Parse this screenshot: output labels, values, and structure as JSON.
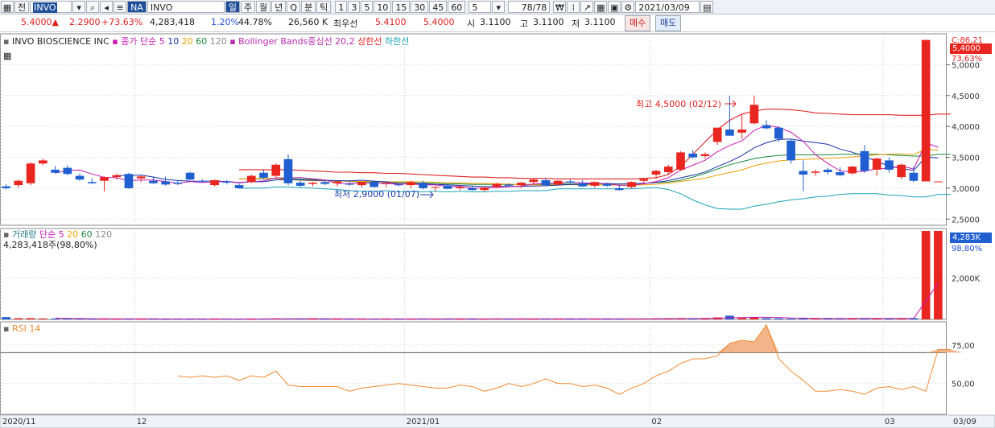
{
  "toolbar": {
    "market_label": "전",
    "symbol_code": "INVO",
    "exchange_badge": "NA",
    "stock_name": "INVO BIOSCIENCE",
    "periods": [
      "일",
      "주",
      "월",
      "년",
      "Q",
      "분",
      "틱"
    ],
    "intervals": [
      "1",
      "3",
      "5",
      "10",
      "15",
      "30",
      "45",
      "60"
    ],
    "interval_value": "5",
    "count_display": "78/78",
    "date_value": "2021/03/09"
  },
  "quote": {
    "price": "5.4000▲",
    "change": "2.2900",
    "change_pct": "+73.63%",
    "volume": "4,283,418",
    "vol_ratio": "1.20%",
    "turnover_pct": "44.78%",
    "amount": "26,560 K",
    "best_label": "최우선",
    "best_ask": "5.4100",
    "best_bid": "5.4000",
    "open_label": "시",
    "open": "3.1100",
    "high_label": "고",
    "high": "3.1100",
    "low_label": "저",
    "low": "3.1100",
    "buy_button": "매수",
    "sell_button": "매도"
  },
  "colors": {
    "up": "#e8251f",
    "down": "#1f5fcf",
    "ma5": "#c81ab4",
    "ma10": "#1632a8",
    "ma20": "#f0a000",
    "ma60": "#1c8a3c",
    "bb_upper": "#e02424",
    "bb_lower": "#1aa3b8",
    "rsi": "#ef8a30"
  },
  "price_legend": {
    "name": "INVO BIOSCIENCE INC",
    "ma_label": "종가 단순",
    "ma_periods": [
      "5",
      "10",
      "20",
      "60",
      "120"
    ],
    "bb_label": "Bollinger Bands중심선 20,2",
    "upper_label": "상한선",
    "lower_label": "하한선"
  },
  "volume_legend": {
    "label": "거래량",
    "ma_label": "단순",
    "ma_periods": [
      "5",
      "20",
      "60",
      "120"
    ],
    "current": "4,283,418주(98,80%)"
  },
  "rsi_legend": {
    "label": "RSI 14"
  },
  "annotations": {
    "high": "최고 4,5000 (02/12)",
    "low": "최저 2,9000 (01/07)",
    "price_current": "5,4000",
    "price_top": "C:86,21",
    "price_pct": "73,63%",
    "volume_current": "4,283K",
    "volume_pct": "98,80%"
  },
  "chart_data": [
    {
      "type": "candlestick",
      "title": "INVO BIOSCIENCE INC",
      "y_ticks": [
        "2,5000",
        "3,0000",
        "3,5000",
        "4,0000",
        "4,5000",
        "5,0000"
      ],
      "ylim": [
        2.4,
        5.5
      ],
      "x_ticks": [
        "2020/11",
        "12",
        "2021/01",
        "02",
        "03",
        "03/09"
      ],
      "candles": [
        {
          "o": 3.03,
          "h": 3.07,
          "l": 2.98,
          "c": 3.0
        },
        {
          "o": 3.05,
          "h": 3.14,
          "l": 3.01,
          "c": 3.12
        },
        {
          "o": 3.08,
          "h": 3.42,
          "l": 3.05,
          "c": 3.4
        },
        {
          "o": 3.4,
          "h": 3.48,
          "l": 3.37,
          "c": 3.45
        },
        {
          "o": 3.3,
          "h": 3.36,
          "l": 3.24,
          "c": 3.25
        },
        {
          "o": 3.33,
          "h": 3.37,
          "l": 3.21,
          "c": 3.23
        },
        {
          "o": 3.2,
          "h": 3.24,
          "l": 3.12,
          "c": 3.14
        },
        {
          "o": 3.1,
          "h": 3.16,
          "l": 3.07,
          "c": 3.08
        },
        {
          "o": 3.12,
          "h": 3.19,
          "l": 2.95,
          "c": 3.18
        },
        {
          "o": 3.18,
          "h": 3.23,
          "l": 3.14,
          "c": 3.21
        },
        {
          "o": 3.23,
          "h": 3.25,
          "l": 2.99,
          "c": 3.0
        },
        {
          "o": 3.16,
          "h": 3.2,
          "l": 3.1,
          "c": 3.19
        },
        {
          "o": 3.12,
          "h": 3.18,
          "l": 3.07,
          "c": 3.08
        },
        {
          "o": 3.11,
          "h": 3.19,
          "l": 3.04,
          "c": 3.06
        },
        {
          "o": 3.09,
          "h": 3.13,
          "l": 3.05,
          "c": 3.07
        },
        {
          "o": 3.25,
          "h": 3.27,
          "l": 3.13,
          "c": 3.14
        },
        {
          "o": 3.12,
          "h": 3.14,
          "l": 3.09,
          "c": 3.11
        },
        {
          "o": 3.05,
          "h": 3.14,
          "l": 3.03,
          "c": 3.13
        },
        {
          "o": 3.11,
          "h": 3.13,
          "l": 3.06,
          "c": 3.09
        },
        {
          "o": 3.05,
          "h": 3.07,
          "l": 2.99,
          "c": 3.0
        },
        {
          "o": 3.1,
          "h": 3.22,
          "l": 3.08,
          "c": 3.2
        },
        {
          "o": 3.25,
          "h": 3.3,
          "l": 3.15,
          "c": 3.17
        },
        {
          "o": 3.2,
          "h": 3.4,
          "l": 3.18,
          "c": 3.38
        },
        {
          "o": 3.47,
          "h": 3.55,
          "l": 3.05,
          "c": 3.08
        },
        {
          "o": 3.09,
          "h": 3.12,
          "l": 3.02,
          "c": 3.04
        },
        {
          "o": 3.07,
          "h": 3.1,
          "l": 3.03,
          "c": 3.09
        },
        {
          "o": 3.1,
          "h": 3.13,
          "l": 3.05,
          "c": 3.07
        },
        {
          "o": 3.08,
          "h": 3.12,
          "l": 3.03,
          "c": 3.11
        },
        {
          "o": 3.07,
          "h": 3.1,
          "l": 3.04,
          "c": 3.06
        },
        {
          "o": 3.05,
          "h": 3.11,
          "l": 3.01,
          "c": 3.1
        },
        {
          "o": 3.1,
          "h": 3.13,
          "l": 3.01,
          "c": 3.02
        },
        {
          "o": 3.08,
          "h": 3.1,
          "l": 3.02,
          "c": 3.09
        },
        {
          "o": 3.06,
          "h": 3.08,
          "l": 3.03,
          "c": 3.05
        },
        {
          "o": 3.05,
          "h": 3.12,
          "l": 3.0,
          "c": 3.1
        },
        {
          "o": 3.09,
          "h": 3.12,
          "l": 2.98,
          "c": 3.0
        },
        {
          "o": 3.01,
          "h": 3.03,
          "l": 2.95,
          "c": 3.02
        },
        {
          "o": 3.04,
          "h": 3.07,
          "l": 2.98,
          "c": 2.99
        },
        {
          "o": 3.0,
          "h": 3.05,
          "l": 2.97,
          "c": 3.02
        },
        {
          "o": 3.0,
          "h": 3.03,
          "l": 2.96,
          "c": 2.97
        },
        {
          "o": 2.97,
          "h": 3.02,
          "l": 2.95,
          "c": 3.01
        },
        {
          "o": 3.02,
          "h": 3.09,
          "l": 3.0,
          "c": 3.07
        },
        {
          "o": 3.06,
          "h": 3.08,
          "l": 3.02,
          "c": 3.04
        },
        {
          "o": 3.05,
          "h": 3.1,
          "l": 3.0,
          "c": 3.09
        },
        {
          "o": 3.1,
          "h": 3.16,
          "l": 3.07,
          "c": 3.14
        },
        {
          "o": 3.13,
          "h": 3.16,
          "l": 3.03,
          "c": 3.05
        },
        {
          "o": 3.06,
          "h": 3.13,
          "l": 3.04,
          "c": 3.12
        },
        {
          "o": 3.11,
          "h": 3.14,
          "l": 3.08,
          "c": 3.09
        },
        {
          "o": 3.08,
          "h": 3.13,
          "l": 3.02,
          "c": 3.03
        },
        {
          "o": 3.04,
          "h": 3.11,
          "l": 3.01,
          "c": 3.1
        },
        {
          "o": 3.07,
          "h": 3.09,
          "l": 3.02,
          "c": 3.04
        },
        {
          "o": 3.0,
          "h": 3.05,
          "l": 2.96,
          "c": 2.97
        },
        {
          "o": 3.02,
          "h": 3.11,
          "l": 3.0,
          "c": 3.1
        },
        {
          "o": 3.12,
          "h": 3.16,
          "l": 3.08,
          "c": 3.15
        },
        {
          "o": 3.22,
          "h": 3.3,
          "l": 3.15,
          "c": 3.28
        },
        {
          "o": 3.26,
          "h": 3.38,
          "l": 3.22,
          "c": 3.35
        },
        {
          "o": 3.3,
          "h": 3.6,
          "l": 3.28,
          "c": 3.58
        },
        {
          "o": 3.56,
          "h": 3.62,
          "l": 3.48,
          "c": 3.5
        },
        {
          "o": 3.52,
          "h": 3.58,
          "l": 3.48,
          "c": 3.55
        },
        {
          "o": 3.75,
          "h": 3.95,
          "l": 3.7,
          "c": 3.98
        },
        {
          "o": 3.95,
          "h": 4.5,
          "l": 3.85,
          "c": 3.85
        },
        {
          "o": 3.9,
          "h": 4.2,
          "l": 3.8,
          "c": 3.95
        },
        {
          "o": 4.05,
          "h": 4.5,
          "l": 4.03,
          "c": 4.35
        },
        {
          "o": 4.02,
          "h": 4.1,
          "l": 3.95,
          "c": 3.97
        },
        {
          "o": 3.98,
          "h": 4.0,
          "l": 3.75,
          "c": 3.8
        },
        {
          "o": 3.77,
          "h": 3.8,
          "l": 3.4,
          "c": 3.45
        },
        {
          "o": 3.28,
          "h": 3.45,
          "l": 2.95,
          "c": 3.22
        },
        {
          "o": 3.25,
          "h": 3.3,
          "l": 3.2,
          "c": 3.27
        },
        {
          "o": 3.3,
          "h": 3.33,
          "l": 3.22,
          "c": 3.26
        },
        {
          "o": 3.26,
          "h": 3.34,
          "l": 3.19,
          "c": 3.21
        },
        {
          "o": 3.24,
          "h": 3.36,
          "l": 3.22,
          "c": 3.35
        },
        {
          "o": 3.6,
          "h": 3.7,
          "l": 3.25,
          "c": 3.28
        },
        {
          "o": 3.3,
          "h": 3.5,
          "l": 3.2,
          "c": 3.48
        },
        {
          "o": 3.45,
          "h": 3.5,
          "l": 3.25,
          "c": 3.3
        },
        {
          "o": 3.18,
          "h": 3.4,
          "l": 3.15,
          "c": 3.38
        },
        {
          "o": 3.25,
          "h": 3.35,
          "l": 3.1,
          "c": 3.12
        },
        {
          "o": 3.11,
          "h": 5.4,
          "l": 3.11,
          "c": 5.4
        },
        {
          "o": 3.11,
          "h": 3.11,
          "l": 3.11,
          "c": 3.11
        }
      ],
      "bollinger": {
        "upper": [
          null,
          null,
          null,
          null,
          null,
          null,
          null,
          null,
          null,
          null,
          null,
          null,
          null,
          null,
          null,
          null,
          null,
          null,
          null,
          3.3,
          3.3,
          3.3,
          3.3,
          3.3,
          3.29,
          3.28,
          3.27,
          3.26,
          3.26,
          3.25,
          3.25,
          3.24,
          3.24,
          3.23,
          3.22,
          3.21,
          3.2,
          3.19,
          3.18,
          3.18,
          3.17,
          3.17,
          3.16,
          3.16,
          3.16,
          3.15,
          3.15,
          3.15,
          3.15,
          3.15,
          3.15,
          3.15,
          3.16,
          3.17,
          3.22,
          3.35,
          3.55,
          3.75,
          3.95,
          4.1,
          4.2,
          4.25,
          4.28,
          4.28,
          4.27,
          4.25,
          4.22,
          4.21,
          4.2,
          4.19,
          4.19,
          4.19,
          4.19,
          4.18,
          4.18,
          4.18,
          4.2,
          4.2
        ],
        "middle": [
          null,
          null,
          null,
          null,
          null,
          null,
          null,
          null,
          null,
          null,
          null,
          null,
          null,
          null,
          null,
          null,
          null,
          null,
          null,
          3.15,
          3.15,
          3.15,
          3.16,
          3.16,
          3.15,
          3.14,
          3.13,
          3.12,
          3.11,
          3.1,
          3.1,
          3.1,
          3.09,
          3.09,
          3.08,
          3.08,
          3.07,
          3.07,
          3.06,
          3.06,
          3.06,
          3.06,
          3.06,
          3.06,
          3.06,
          3.07,
          3.07,
          3.07,
          3.07,
          3.07,
          3.07,
          3.07,
          3.08,
          3.09,
          3.1,
          3.13,
          3.18,
          3.24,
          3.31,
          3.38,
          3.43,
          3.48,
          3.51,
          3.53,
          3.54,
          3.54,
          3.54,
          3.54,
          3.55,
          3.55,
          3.55,
          3.55,
          3.54,
          3.53,
          3.52,
          3.52,
          3.55,
          3.55
        ],
        "lower": [
          null,
          null,
          null,
          null,
          null,
          null,
          null,
          null,
          null,
          null,
          null,
          null,
          null,
          null,
          null,
          null,
          null,
          null,
          null,
          3.0,
          3.0,
          3.0,
          3.02,
          3.02,
          3.01,
          3.0,
          2.99,
          2.98,
          2.96,
          2.95,
          2.95,
          2.96,
          2.94,
          2.95,
          2.94,
          2.95,
          2.94,
          2.95,
          2.94,
          2.94,
          2.95,
          2.95,
          2.96,
          2.96,
          2.96,
          2.99,
          2.99,
          2.99,
          2.99,
          2.99,
          2.99,
          2.99,
          3.0,
          3.01,
          2.98,
          2.91,
          2.81,
          2.73,
          2.67,
          2.66,
          2.66,
          2.71,
          2.74,
          2.78,
          2.81,
          2.83,
          2.86,
          2.87,
          2.9,
          2.91,
          2.91,
          2.91,
          2.89,
          2.88,
          2.86,
          2.86,
          2.9,
          2.9
        ]
      }
    },
    {
      "type": "bar",
      "title": "거래량",
      "y_ticks": [
        "2,000K"
      ],
      "ylim": [
        0,
        4400000
      ],
      "volumes": [
        110000,
        55000,
        60000,
        45000,
        40000,
        38000,
        30000,
        28000,
        26000,
        25000,
        26000,
        24000,
        26000,
        22000,
        25000,
        20000,
        22000,
        21000,
        23000,
        20000,
        22000,
        30000,
        45000,
        42000,
        35000,
        24000,
        26000,
        24000,
        25000,
        23000,
        28000,
        22000,
        24000,
        26000,
        30000,
        24000,
        28000,
        22000,
        23000,
        24000,
        32000,
        28000,
        30000,
        26000,
        30000,
        28000,
        24000,
        25000,
        30000,
        26000,
        28000,
        35000,
        40000,
        42000,
        44000,
        48000,
        45000,
        50000,
        95000,
        180000,
        70000,
        110000,
        60000,
        50000,
        40000,
        45000,
        50000,
        42000,
        44000,
        46000,
        48000,
        45000,
        50000,
        55000,
        60000,
        4283418,
        4283418
      ],
      "ma5": [
        null,
        null,
        null,
        null,
        62000,
        47600,
        42600,
        36200,
        32400,
        29400,
        27000,
        25800,
        25400,
        24600,
        24600,
        23400,
        23000,
        22000,
        22200,
        21200,
        21600,
        23200,
        28000,
        31800,
        34800,
        35200,
        34400,
        30600,
        26800,
        24400,
        25200,
        24400,
        24800,
        24600,
        26000,
        25200,
        26400,
        26000,
        25400,
        24200,
        25800,
        25800,
        27400,
        28000,
        29200,
        28400,
        27600,
        26600,
        27400,
        26600,
        26600,
        28800,
        31800,
        34200,
        37800,
        41800,
        43800,
        45800,
        56400,
        83600,
        89000,
        101000,
        103000,
        94000,
        66000,
        61000,
        49000,
        47400,
        44200,
        45400,
        46000,
        45000,
        46600,
        48800,
        51600,
        888308,
        1743844
      ]
    },
    {
      "type": "line",
      "title": "RSI 14",
      "y_ticks": [
        "50,00",
        "75,00"
      ],
      "ylim": [
        30,
        90
      ],
      "reference_line": 70,
      "values": [
        null,
        null,
        null,
        null,
        null,
        null,
        null,
        null,
        null,
        null,
        null,
        null,
        null,
        null,
        55,
        54,
        55,
        54,
        55,
        52,
        55,
        54,
        58,
        49,
        48,
        48,
        48,
        48,
        45,
        47,
        48,
        49,
        50,
        49,
        48,
        47,
        47,
        49,
        48,
        45,
        47,
        50,
        48,
        50,
        53,
        50,
        50,
        48,
        49,
        47,
        43,
        47,
        50,
        55,
        58,
        63,
        66,
        66,
        68,
        76,
        78,
        77,
        88,
        66,
        58,
        52,
        45,
        45,
        46,
        45,
        43,
        47,
        48,
        46,
        48,
        45,
        72,
        72
      ]
    }
  ]
}
